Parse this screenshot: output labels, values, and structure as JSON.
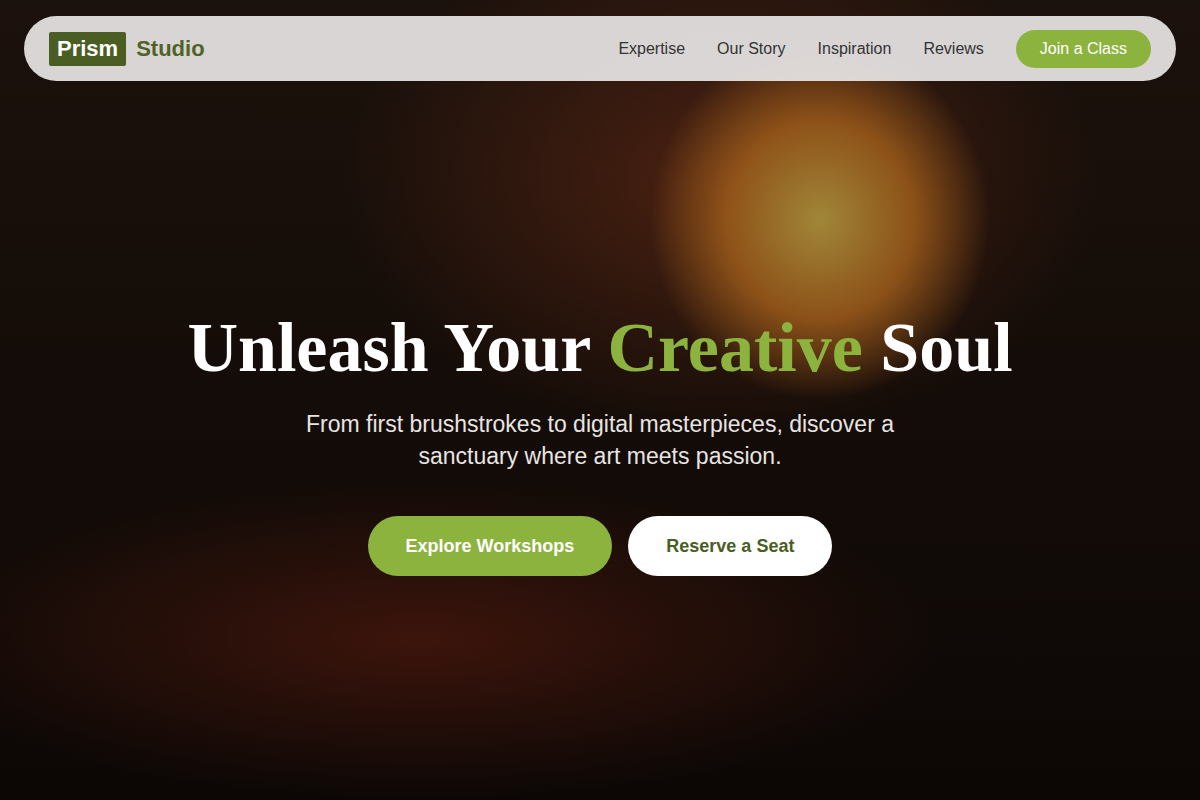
{
  "logo": {
    "badge": "Prism",
    "name": "Studio"
  },
  "nav": {
    "links": [
      {
        "label": "Expertise"
      },
      {
        "label": "Our Story"
      },
      {
        "label": "Inspiration"
      },
      {
        "label": "Reviews"
      }
    ],
    "cta": "Join a Class"
  },
  "hero": {
    "title": [
      {
        "text": "Unleash Your ",
        "highlight": false
      },
      {
        "text": "Creative",
        "highlight": true
      },
      {
        "text": " Soul",
        "highlight": false
      }
    ],
    "subtitle": "From first brushstrokes to digital masterpieces, discover a sanctuary where art meets passion.",
    "buttons": [
      {
        "label": "Explore Workshops",
        "kind": "primary"
      },
      {
        "label": "Reserve a Seat",
        "kind": "secondary"
      }
    ]
  }
}
